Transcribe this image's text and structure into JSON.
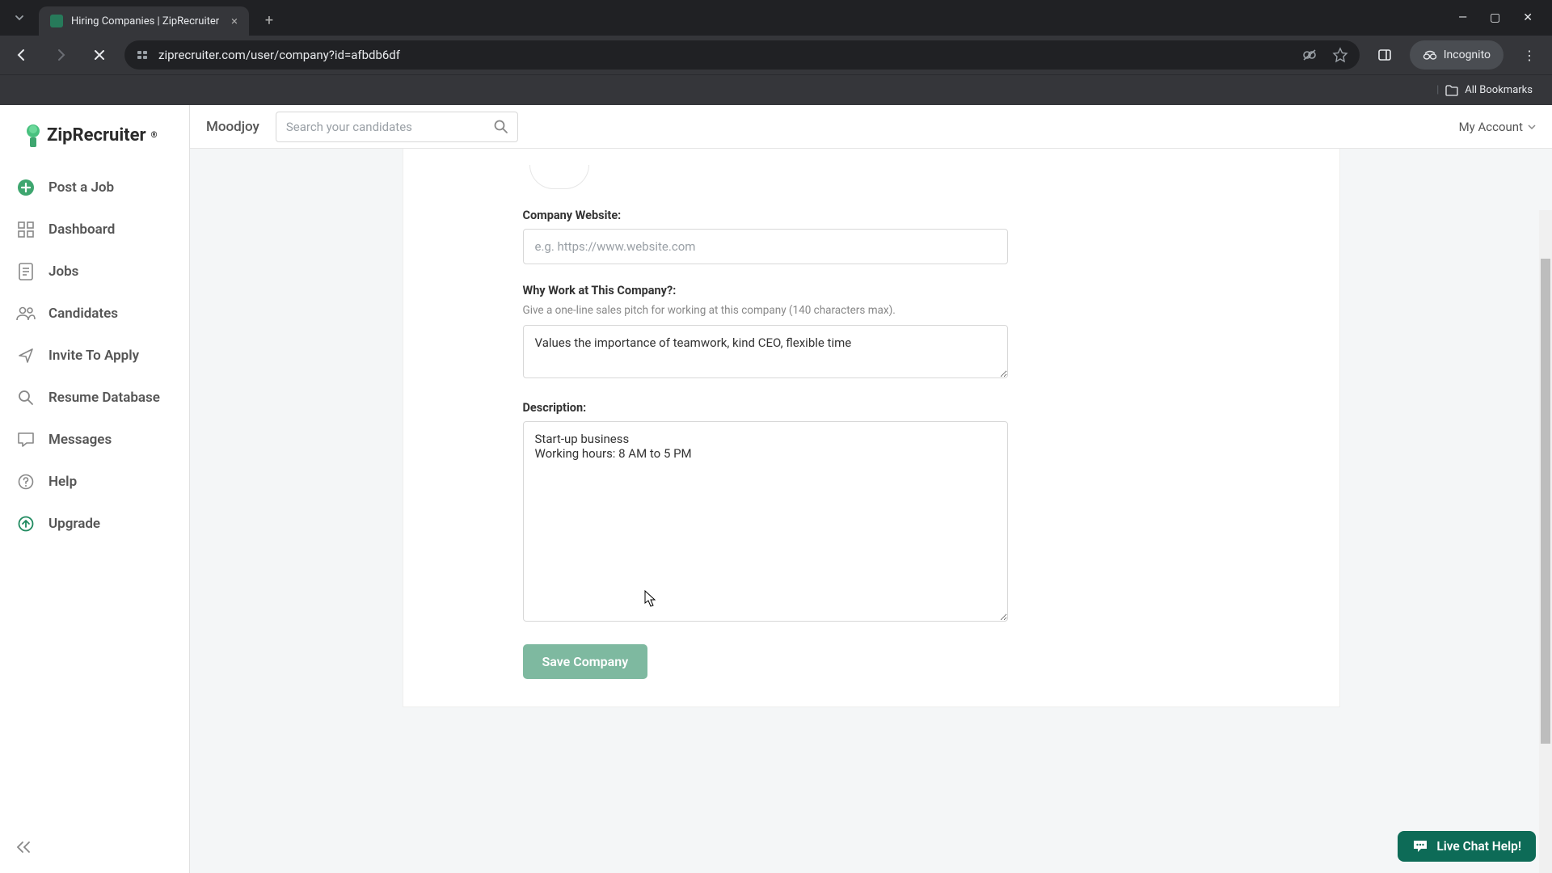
{
  "browser": {
    "tab_title": "Hiring Companies | ZipRecruiter",
    "url": "ziprecruiter.com/user/company?id=afbdb6df",
    "incognito_label": "Incognito",
    "bookmarks_label": "All Bookmarks"
  },
  "logo_text": "ZipRecruiter",
  "sidebar": {
    "items": [
      {
        "label": "Post a Job",
        "icon": "plus-circle-icon"
      },
      {
        "label": "Dashboard",
        "icon": "grid-icon"
      },
      {
        "label": "Jobs",
        "icon": "document-icon"
      },
      {
        "label": "Candidates",
        "icon": "people-icon"
      },
      {
        "label": "Invite To Apply",
        "icon": "send-icon"
      },
      {
        "label": "Resume Database",
        "icon": "search-icon"
      },
      {
        "label": "Messages",
        "icon": "chat-icon"
      },
      {
        "label": "Help",
        "icon": "question-icon"
      },
      {
        "label": "Upgrade",
        "icon": "up-arrow-icon"
      }
    ]
  },
  "topbar": {
    "company": "Moodjoy",
    "search_placeholder": "Search your candidates",
    "account_label": "My Account"
  },
  "form": {
    "website_label": "Company Website:",
    "website_placeholder": "e.g. https://www.website.com",
    "website_value": "",
    "why_label": "Why Work at This Company?:",
    "why_hint": "Give a one-line sales pitch for working at this company (140 characters max).",
    "why_value": "Values the importance of teamwork, kind CEO, flexible time",
    "desc_label": "Description:",
    "desc_value": "Start-up business\nWorking hours: 8 AM to 5 PM",
    "save_label": "Save Company"
  },
  "chat_label": "Live Chat Help!"
}
